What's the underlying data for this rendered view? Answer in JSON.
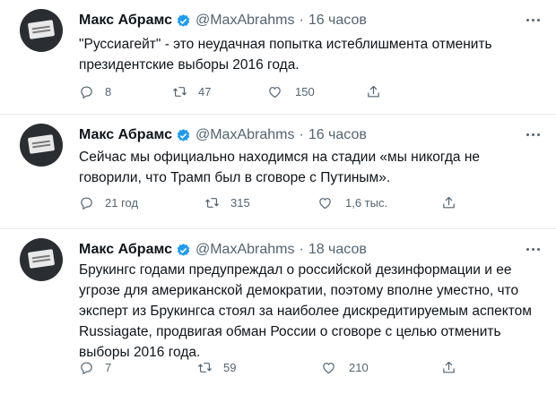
{
  "tweets": [
    {
      "author": "Макс Абрамс",
      "handle": "@MaxAbrahms",
      "separator": "·",
      "time": "16 часов",
      "text": "\"Руссиагейт\" - это неудачная попытка истеблишмента отменить президентские выборы 2016 года.",
      "replies": "8",
      "retweets": "47",
      "likes": "150"
    },
    {
      "author": "Макс Абрамс",
      "handle": "@MaxAbrahms",
      "separator": "·",
      "time": "16 часов",
      "text": "Сейчас мы официально находимся на стадии «мы никогда не говорили, что Трамп был в сговоре с Путиным».",
      "replies": "21 год",
      "retweets": "315",
      "likes": "1,6 тыс."
    },
    {
      "author": "Макс Абрамс",
      "handle": "@MaxAbrahms",
      "separator": "·",
      "time": "18 часов",
      "text": "Брукингс годами предупреждал о российской дезинформации и ее угрозе для американской демократии, поэтому вполне уместно, что эксперт из Брукингса стоял за наиболее дискредитируемым аспектом Russiagate, продвигая обман России о сговоре с целью отменить выборы 2016 года.",
      "replies": "7",
      "retweets": "59",
      "likes": "210"
    }
  ],
  "colors": {
    "verified": "#1d9bf0",
    "muted": "#536471",
    "text": "#0f1419",
    "divider": "#e6ecf0"
  },
  "icons": [
    "verified-badge-icon",
    "more-options-icon",
    "reply-icon",
    "retweet-icon",
    "like-icon",
    "share-icon"
  ]
}
